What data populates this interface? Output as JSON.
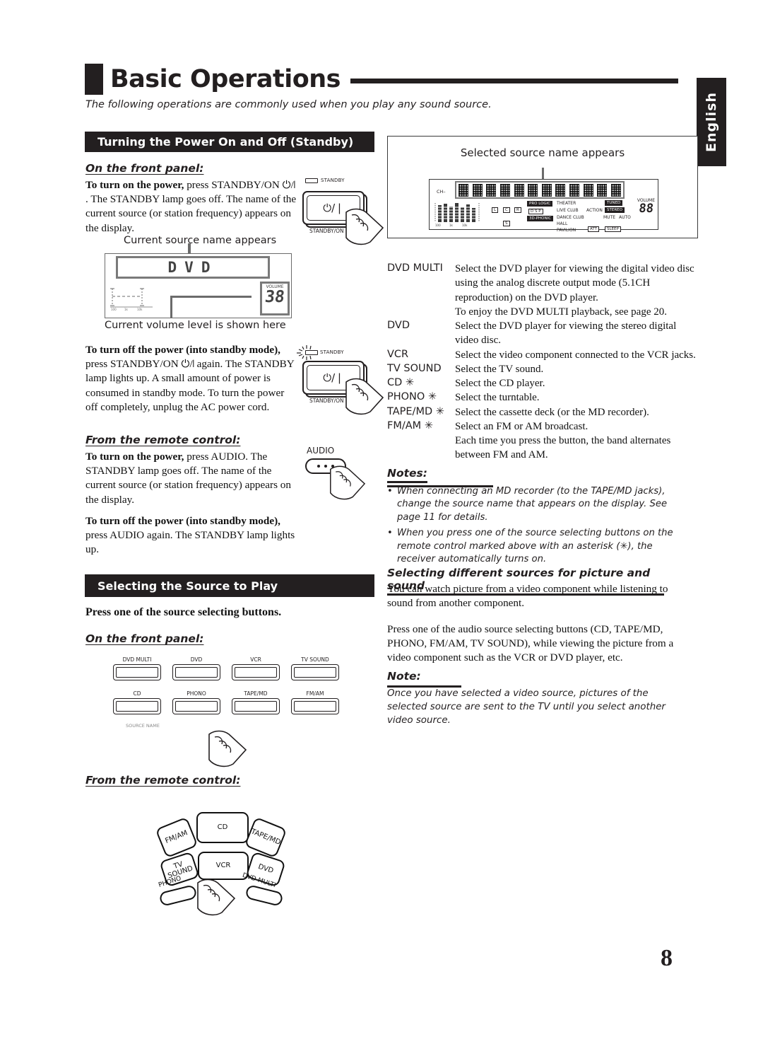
{
  "header": {
    "title": "Basic Operations",
    "intro": "The following operations are commonly used when you play any sound source.",
    "language_tab": "English"
  },
  "page_number": "8",
  "sections": {
    "power": {
      "bar_label": "Turning the Power On and Off (Standby)",
      "front_panel_label": "On the front panel:",
      "turn_on_bold": "To turn on the power,",
      "turn_on_rest": " press STANDBY/ON ⏻/❘ .",
      "turn_on_body": "The STANDBY lamp goes off. The name of the current source (or station frequency) appears on the display.",
      "caption_source_name": "Current source name appears",
      "caption_volume_level": "Current volume level is shown here",
      "turn_off_bold": "To turn off the power (into standby mode),",
      "turn_off_rest": " press STANDBY/ON ⏻/❘  again.",
      "turn_off_body": "The STANDBY lamp lights up. A small amount of power is consumed in standby mode. To turn the power off completely, unplug the AC power cord.",
      "remote_label": "From the remote control:",
      "remote_on_bold": "To turn on the power,",
      "remote_on_rest": " press AUDIO.",
      "remote_on_body": "The STANDBY lamp goes off. The name of the current source (or station frequency) appears on the display.",
      "remote_off_bold": "To turn off the power (into standby mode),",
      "remote_off_rest": " press AUDIO again.",
      "remote_off_body": "The STANDBY lamp lights up."
    },
    "source": {
      "bar_label": "Selecting the Source to Play",
      "press_one": "Press one of the source selecting buttons.",
      "front_panel_label": "On the front panel:",
      "remote_label": "From the remote control:"
    }
  },
  "figures": {
    "standby_button": {
      "lamp_label": "STANDBY",
      "glyph": "⏻/❘",
      "caption": "STANDBY/ON"
    },
    "audio_key": {
      "label": "AUDIO"
    },
    "front_display": {
      "source_text": "DVD",
      "volume_label": "VOLUME",
      "volume_value": "38",
      "scale_ticks": [
        "100",
        "1k",
        "10k"
      ]
    },
    "display_card": {
      "caption": "Selected source name appears",
      "ch_label": "CH–",
      "scale_ticks": [
        "100",
        "1k",
        "10k"
      ],
      "channel_chips": [
        "L",
        "C",
        "R",
        "S"
      ],
      "indicators": [
        "PRO LOGIC",
        "D S P",
        "3D-PHONIC",
        "THEATER",
        "LIVE CLUB",
        "DANCE CLUB",
        "HALL",
        "PAVILION",
        "ACTION",
        "TUNED",
        "STEREO",
        "MUTE",
        "AUTO",
        "ATT",
        "SLEEP"
      ],
      "volume_label": "VOLUME",
      "volume_value": "88"
    },
    "front_panel_buttons": {
      "row1": [
        "DVD MULTI",
        "DVD",
        "VCR",
        "TV SOUND"
      ],
      "row2": [
        "CD",
        "PHONO",
        "TAPE/MD",
        "FM/AM"
      ],
      "source_name_label": "SOURCE NAME"
    },
    "remote_keys": [
      "FM/AM",
      "CD",
      "TAPE/MD",
      "TV SOUND",
      "VCR",
      "DVD",
      "PHONO",
      "DVD MULTI"
    ]
  },
  "source_table": [
    {
      "name": "DVD MULTI",
      "desc": "Select the DVD player for viewing the digital video disc using the analog discrete output mode (5.1CH reproduction) on the DVD player.\nTo enjoy the DVD MULTI playback, see page 20."
    },
    {
      "name": "DVD",
      "desc": "Select the DVD player for viewing the stereo digital video disc."
    },
    {
      "name": "VCR",
      "desc": "Select the video component connected to the VCR jacks."
    },
    {
      "name": "TV SOUND",
      "desc": "Select the TV sound."
    },
    {
      "name": "CD ✳",
      "desc": "Select the CD player."
    },
    {
      "name": "PHONO ✳",
      "desc": "Select the turntable."
    },
    {
      "name": "TAPE/MD ✳",
      "desc": "Select the cassette deck (or the MD recorder)."
    },
    {
      "name": "FM/AM ✳",
      "desc": "Select an FM or AM broadcast.\nEach time you press the button, the band alternates between FM and AM."
    }
  ],
  "notes": {
    "heading": "Notes:",
    "items": [
      "When connecting an MD recorder (to the TAPE/MD jacks), change the source name that appears on the display. See page 11 for details.",
      "When you press one of the source selecting buttons on the remote control marked above with an asterisk (✳), the receiver automatically turns on."
    ],
    "bullet": "•"
  },
  "picture_sound": {
    "heading": "Selecting different sources for picture and sound",
    "para1": "You can watch picture from a video component while listening to sound from another component.",
    "para2": "Press one of the audio source selecting buttons (CD, TAPE/MD, PHONO, FM/AM, TV SOUND), while viewing the picture from a video component such as the VCR or DVD player, etc.",
    "note_heading": "Note:",
    "note_body": "Once you have selected a video source, pictures of the selected source are sent to the TV until you select another video source."
  }
}
